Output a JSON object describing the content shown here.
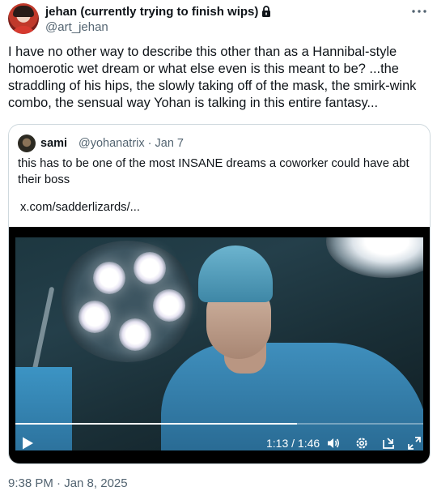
{
  "author": {
    "display_name": "jehan (currently trying to finish wips)",
    "handle": "@art_jehan",
    "avatar_icon": "avatar-image",
    "protected_icon": "lock-icon"
  },
  "more_icon": "more-horizontal-icon",
  "tweet": {
    "text": "I have no other way to describe this other than as a Hannibal-style homoerotic wet dream or what else even is this meant to be? ...the straddling of his hips, the slowly taking off of the mask, the smirk-wink combo, the sensual way Yohan is talking in this entire fantasy...",
    "timestamp": "9:38 PM · Jan 8, 2025"
  },
  "quote": {
    "display_name": "sami",
    "meta": "@yohanatrix · Jan 7",
    "text": "this has to be one of the most INSANE dreams a coworker could have abt their boss",
    "link": "x.com/sadderlizards/..."
  },
  "video": {
    "time": "1:13 / 1:46",
    "progress": 0.69,
    "icons": [
      "play-icon",
      "volume-icon",
      "settings-icon",
      "dock-icon",
      "fullscreen-icon"
    ]
  },
  "colors": {
    "text_primary": "#0f1419",
    "text_secondary": "#536471",
    "border": "#cfd9de"
  }
}
